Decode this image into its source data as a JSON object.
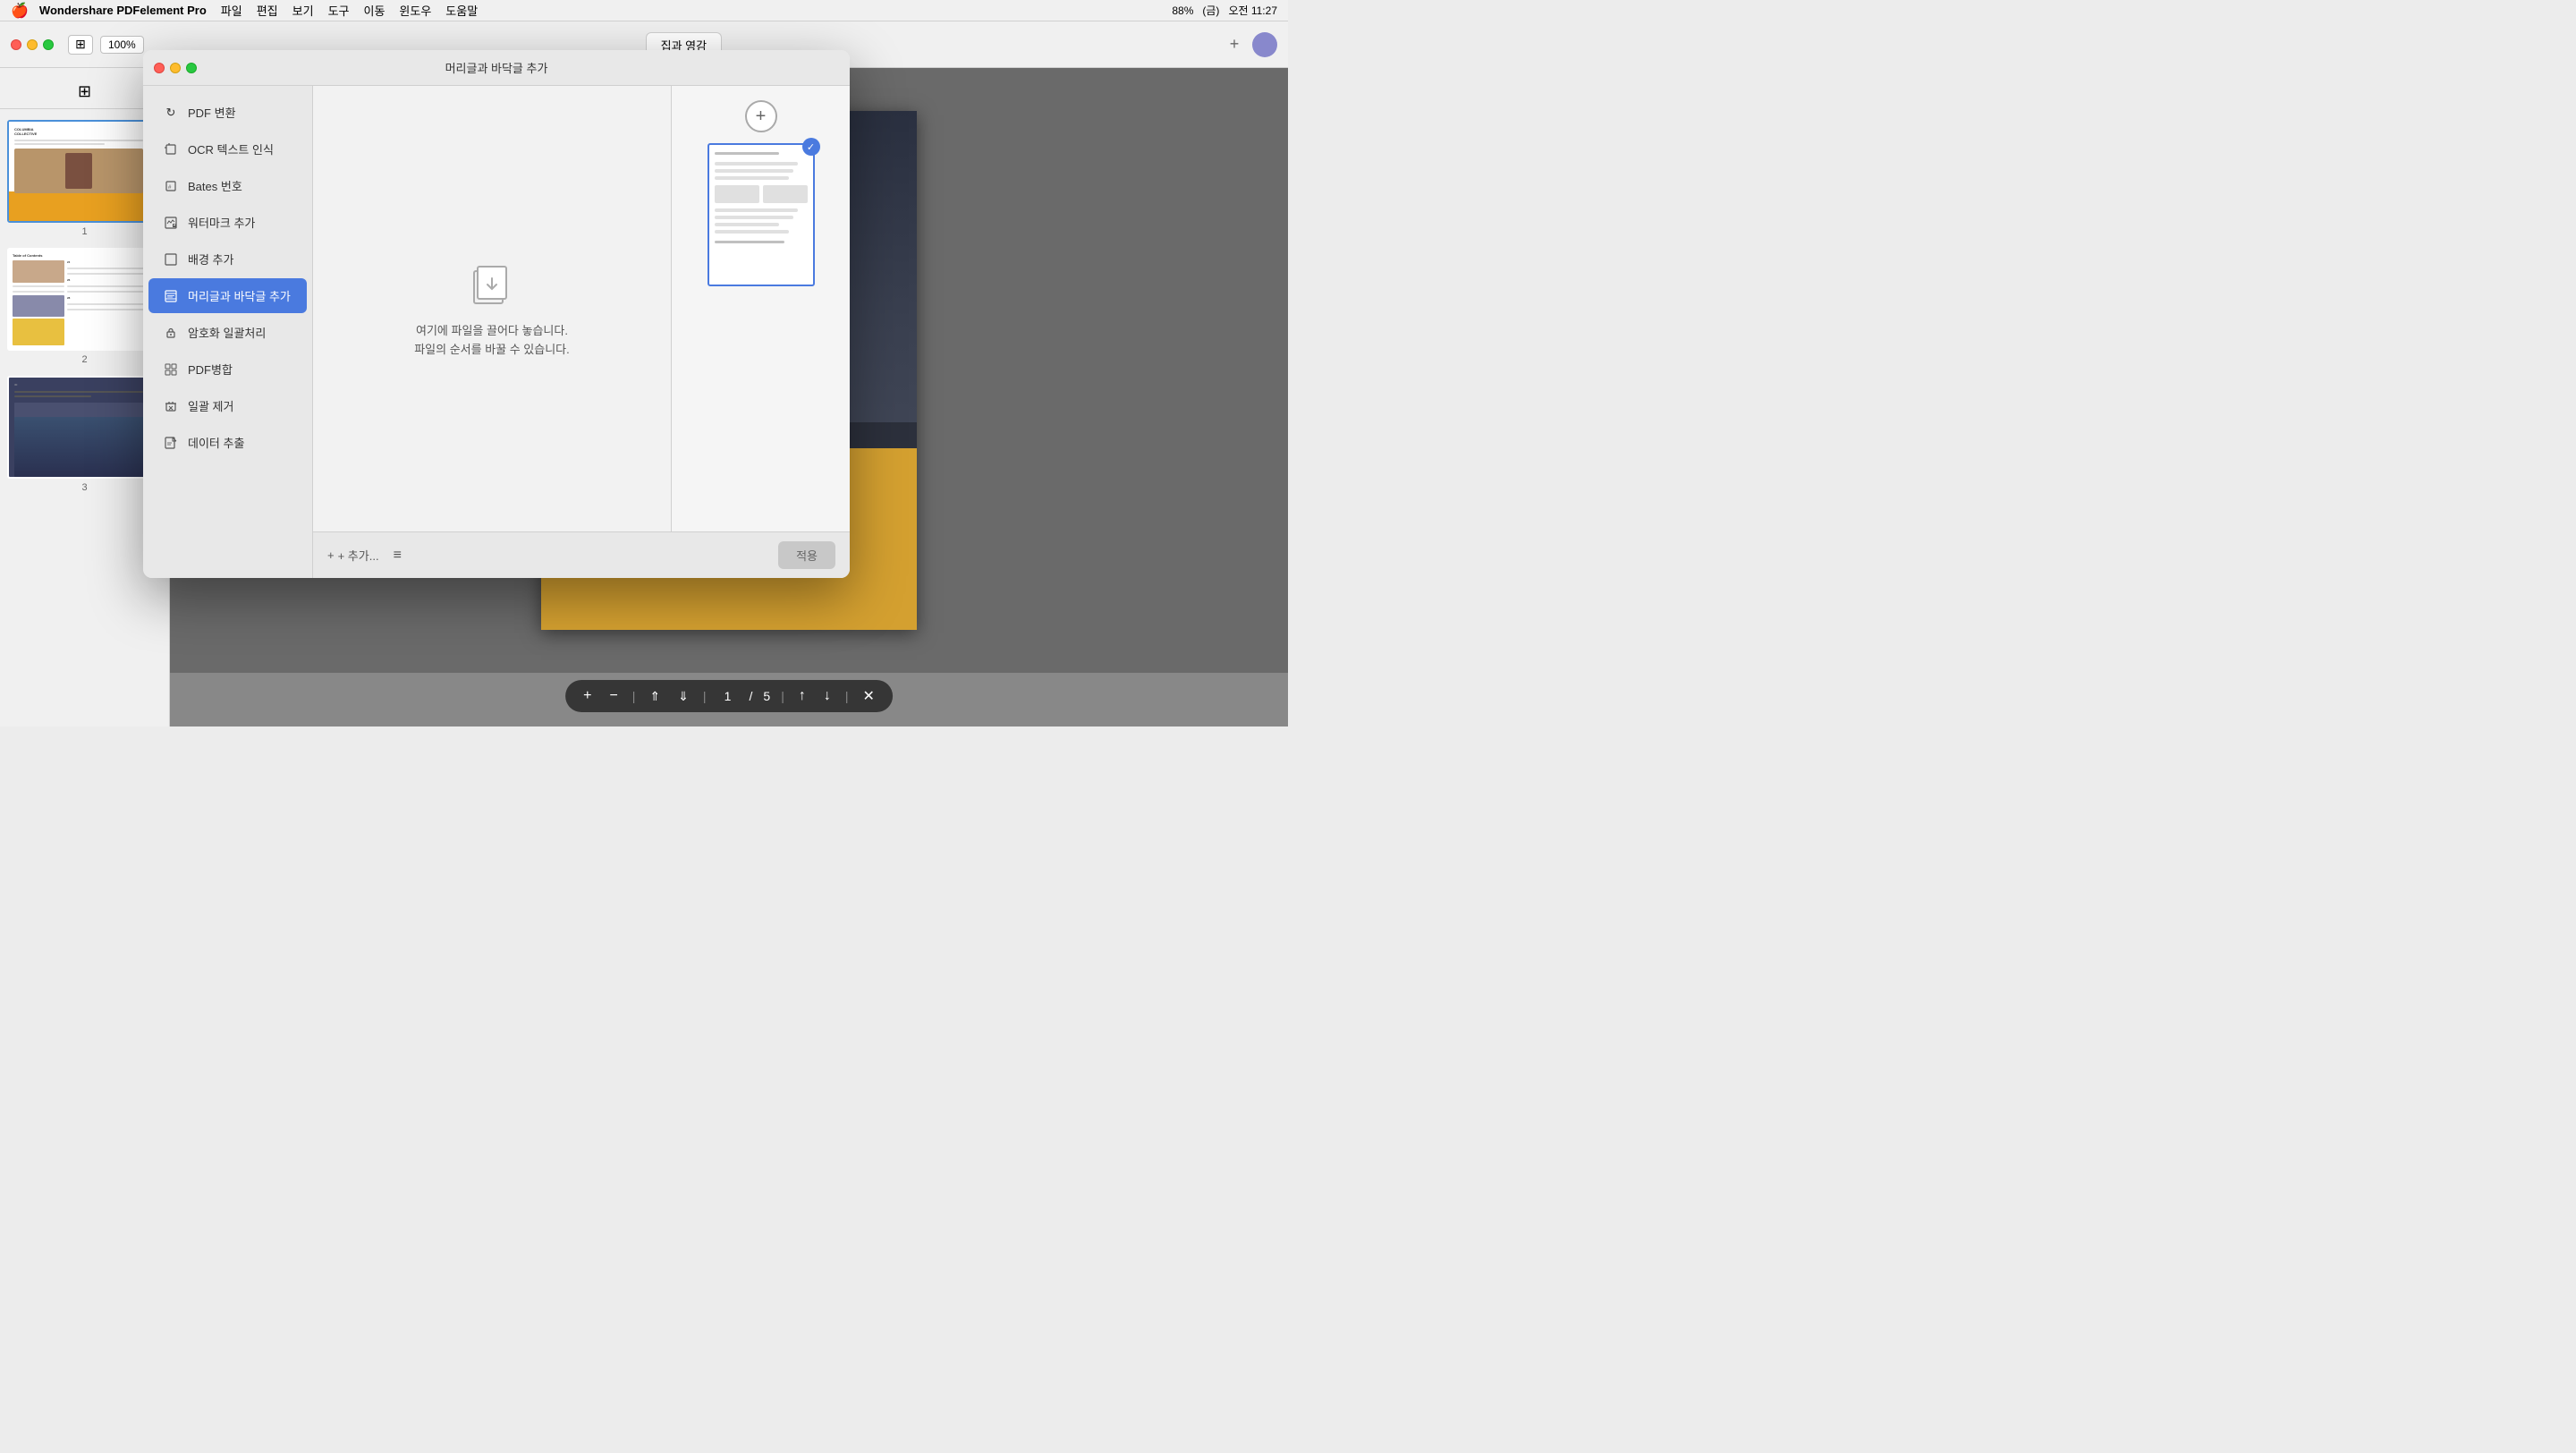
{
  "menubar": {
    "apple_icon": "🍎",
    "app_name": "Wondershare PDFelement Pro",
    "menus": [
      "파일",
      "편집",
      "보기",
      "도구",
      "이동",
      "윈도우",
      "도움말"
    ],
    "time": "오전 11:27",
    "day": "(금)",
    "battery": "88%"
  },
  "toolbar": {
    "zoom_level": "100%",
    "tab_name": "집과 영감"
  },
  "sidebar": {
    "tools_icon": "⊞",
    "pages": [
      "1",
      "2",
      "3"
    ]
  },
  "modal": {
    "title": "머리글과 바닥글 추가",
    "traffic_lights": [
      "close",
      "minimize",
      "maximize"
    ],
    "menu_items": [
      {
        "id": "pdf-convert",
        "label": "PDF 변환",
        "icon": "↻"
      },
      {
        "id": "ocr",
        "label": "OCR 텍스트 인식",
        "icon": "↑□"
      },
      {
        "id": "bates",
        "label": "Bates 번호",
        "icon": "□#"
      },
      {
        "id": "watermark",
        "label": "워터마크 추가",
        "icon": "☑"
      },
      {
        "id": "background",
        "label": "배경 추가",
        "icon": "□"
      },
      {
        "id": "header-footer",
        "label": "머리글과 바닥글 추가",
        "icon": "≡□",
        "active": true
      },
      {
        "id": "encrypt",
        "label": "암호화 일괄처리",
        "icon": "🔒"
      },
      {
        "id": "pdf-merge",
        "label": "PDF병합",
        "icon": "⊞"
      },
      {
        "id": "batch-remove",
        "label": "일괄 제거",
        "icon": "🗑"
      },
      {
        "id": "data-extract",
        "label": "데이터 추출",
        "icon": "↗□"
      }
    ],
    "drop_zone": {
      "text_line1": "여기에 파일을 끌어다 놓습니다.",
      "text_line2": "파일의 순서를 바꿀 수 있습니다."
    },
    "footer": {
      "add_label": "+ 추가...",
      "apply_label": "적용"
    },
    "collapse_arrow": "«"
  },
  "bottom_nav": {
    "zoom_in": "+",
    "zoom_out": "−",
    "fit_width": "↑",
    "fit_height": "↓",
    "current_page": "1",
    "total_pages": "5",
    "prev_page": "↑",
    "next_page": "↓",
    "close": "✕"
  }
}
